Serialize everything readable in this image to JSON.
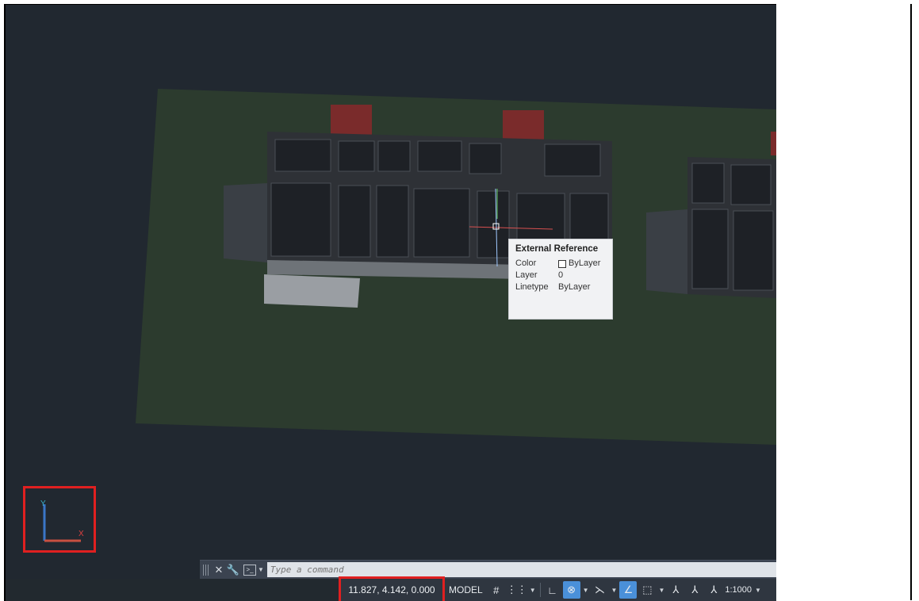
{
  "tooltip": {
    "title": "External Reference",
    "rows": [
      {
        "key": "Color",
        "value": "ByLayer"
      },
      {
        "key": "Layer",
        "value": "0"
      },
      {
        "key": "Linetype",
        "value": "ByLayer"
      }
    ]
  },
  "ucs_icon": {
    "x_label": "X",
    "y_label": "Y"
  },
  "command_line": {
    "placeholder": "Type a command"
  },
  "status_bar": {
    "coordinates": "11.827, 4.142, 0.000",
    "model_label": "MODEL",
    "annotation_scale": "1:1000"
  },
  "colors": {
    "canvas_background": "#212830",
    "ground_plane": "#2c3b2e",
    "highlight_box": "#e02020",
    "active_toggle": "#4a90d9"
  }
}
